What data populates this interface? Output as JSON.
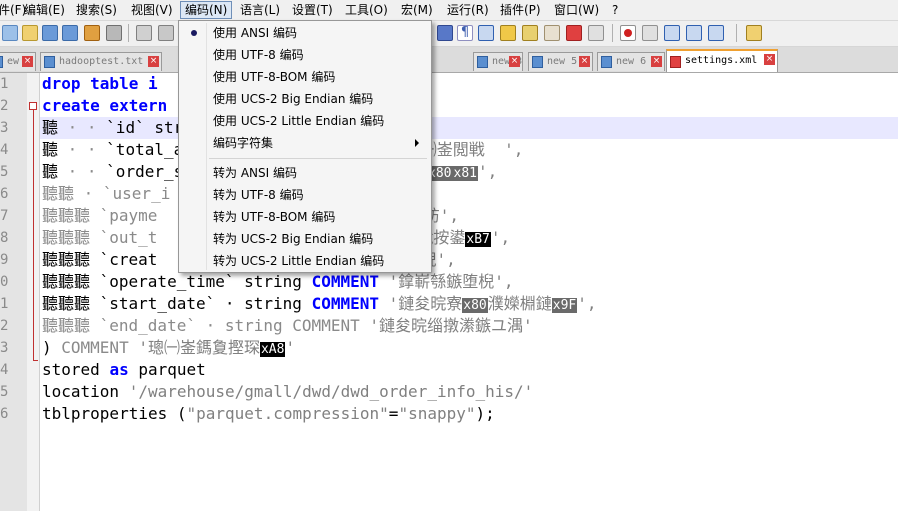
{
  "menubar": {
    "items": [
      "件(F)",
      "编辑(E)",
      "搜索(S)",
      "视图(V)",
      "编码(N)",
      "语言(L)",
      "设置(T)",
      "工具(O)",
      "宏(M)",
      "运行(R)",
      "插件(P)",
      "窗口(W)",
      "?"
    ],
    "open_item": "编码(N)"
  },
  "tabs": [
    {
      "label": "ew 2",
      "active": false
    },
    {
      "label": "hadooptest.txt",
      "active": false
    },
    {
      "label": "new 3",
      "active": false
    },
    {
      "label": "new 5",
      "active": false
    },
    {
      "label": "new 6",
      "active": false
    },
    {
      "label": "settings.xml",
      "active": true
    }
  ],
  "tab_close_glyph": "×",
  "encoding_menu": {
    "items": [
      {
        "label": "使用 ANSI 编码",
        "checked": true
      },
      {
        "label": "使用 UTF-8 编码"
      },
      {
        "label": "使用 UTF-8-BOM 编码"
      },
      {
        "label": "使用 UCS-2 Big Endian 编码"
      },
      {
        "label": "使用 UCS-2 Little Endian 编码"
      },
      {
        "label": "编码字符集",
        "submenu": true
      },
      {
        "label": "转为 ANSI 编码"
      },
      {
        "label": "转为 UTF-8 编码"
      },
      {
        "label": "转为 UTF-8-BOM 编码"
      },
      {
        "label": "转为 UCS-2 Big Endian 编码"
      },
      {
        "label": "转为 UCS-2 Little Endian 编码"
      }
    ]
  },
  "gutter": {
    "line_numbers": [
      "1",
      "2",
      "3",
      "4",
      "5",
      "6",
      "7",
      "8",
      "9",
      "0",
      "1",
      "2",
      "3",
      "4",
      "5",
      "6"
    ]
  },
  "editor": {
    "lines": [
      {
        "t": [
          [
            "kw",
            "drop table i"
          ],
          [
            "norm",
            "                    "
          ],
          [
            "norm",
            "_his;"
          ]
        ]
      },
      {
        "t": [
          [
            "kw",
            "create extern"
          ],
          [
            "norm",
            "                   "
          ],
          [
            "norm",
            "o_his("
          ]
        ]
      },
      {
        "t": [
          [
            "norm",
            "聽 "
          ],
          [
            "gray",
            "· · "
          ],
          [
            "norm",
            "`id` str"
          ],
          [
            "norm",
            "                    "
          ],
          [
            "str2",
            "悝彿',"
          ]
        ]
      },
      {
        "t": [
          [
            "norm",
            "聽 "
          ],
          [
            "gray",
            "· · "
          ],
          [
            "norm",
            "`total_a"
          ],
          [
            "norm",
            "               "
          ],
          [
            "kw",
            "OMMENT"
          ],
          [
            "norm",
            " "
          ],
          [
            "str",
            "'璁㈠崟閲戦  ',"
          ]
        ]
      },
      {
        "t": [
          [
            "norm",
            "聽 "
          ],
          [
            "gray",
            "· · "
          ],
          [
            "norm",
            "`order_s"
          ],
          [
            "norm",
            "                 "
          ],
          [
            "str",
            "璁㈠崟鐘舵"
          ],
          [
            "ctrl2",
            "x80"
          ],
          [
            "ctrl2",
            "x81"
          ],
          [
            "str",
            "',"
          ]
        ]
      },
      {
        "t": [
          [
            "gray",
            "聽聽 · `user_i"
          ],
          [
            "norm",
            "                 "
          ],
          [
            "gray",
            "丄堝id' ,"
          ]
        ]
      },
      {
        "t": [
          [
            "gray",
            "聽聽聽 `payme"
          ],
          [
            "norm",
            "                  "
          ],
          [
            "str",
            "'鏀  粯鏂瑰紡',"
          ]
        ]
      },
      {
        "t": [
          [
            "gray",
            "聽聽聽 `out_t"
          ],
          [
            "norm",
            "                 "
          ],
          [
            "gray",
            "T "
          ],
          [
            "str",
            "'鏀  粯娴佹按鍙"
          ],
          [
            "ctrl",
            "xB7"
          ],
          [
            "str",
            "',"
          ]
        ]
      },
      {
        "t": [
          [
            "norm",
            "聽聽聽 `creat"
          ],
          [
            "norm",
            "                  "
          ],
          [
            "str",
            "'鍒涘缓鏃堕棿',"
          ]
        ]
      },
      {
        "t": [
          [
            "norm",
            "聽聽聽 `operate_time` string "
          ],
          [
            "kw",
            "COMMENT"
          ],
          [
            "str",
            " '鎿嶄綔鏃堕棿',"
          ]
        ]
      },
      {
        "t": [
          [
            "norm",
            "聽聽聽 `start_date` · string "
          ],
          [
            "kw",
            "COMMENT"
          ],
          [
            "str",
            " '鏈夋晥寮"
          ],
          [
            "ctrl2",
            "x80"
          ],
          [
            "str",
            "濮嬫棩鏈"
          ],
          [
            "ctrl2",
            "x9F"
          ],
          [
            "str",
            "',"
          ]
        ]
      },
      {
        "t": [
          [
            "gray",
            "聽聽聽 `end_date` · string COMMENT "
          ],
          [
            "str",
            "'鏈夋晥缁撴潫鏃ユ湡'"
          ]
        ]
      },
      {
        "t": [
          [
            "norm",
            ") "
          ],
          [
            "gray",
            "COMMENT "
          ],
          [
            "str",
            "'璁㈠崟鎷夐摼琛"
          ],
          [
            "ctrl",
            "xA8"
          ],
          [
            "str",
            "'"
          ]
        ]
      },
      {
        "t": [
          [
            "norm",
            "stored "
          ],
          [
            "kw",
            "as"
          ],
          [
            "norm",
            " parquet"
          ]
        ]
      },
      {
        "t": [
          [
            "norm",
            "location "
          ],
          [
            "str",
            "'/warehouse/gmall/dwd/dwd_order_info_his/'"
          ]
        ]
      },
      {
        "t": [
          [
            "norm",
            "tblproperties "
          ],
          [
            "norm",
            "("
          ],
          [
            "str",
            "\"parquet.compression\""
          ],
          [
            "norm",
            "="
          ],
          [
            "str",
            "\"snappy\""
          ],
          [
            "norm",
            ");"
          ]
        ]
      }
    ]
  }
}
